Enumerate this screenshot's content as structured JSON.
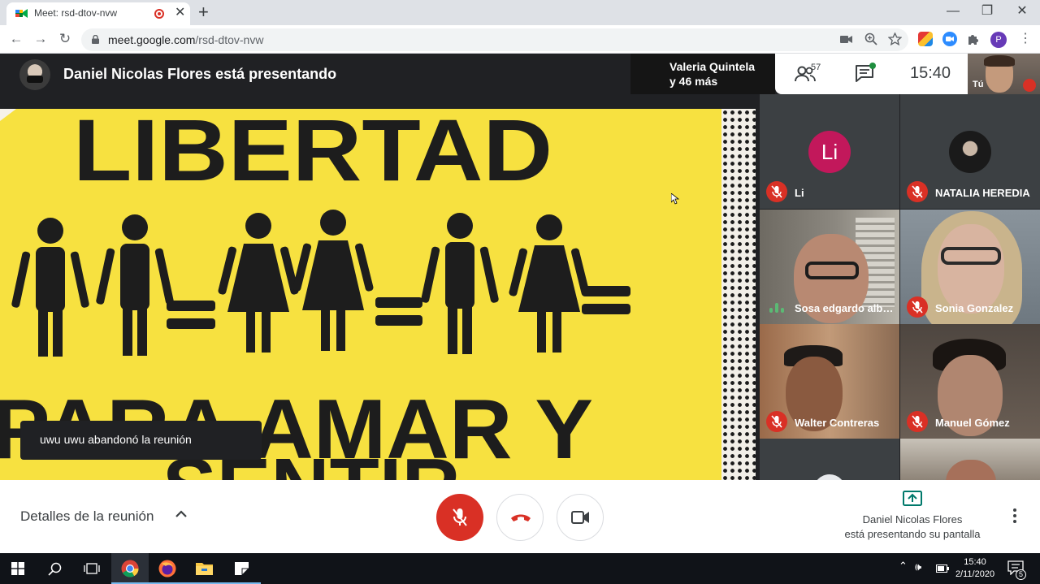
{
  "browser": {
    "tab_title": "Meet: rsd-dtov-nvw",
    "tab_close": "✕",
    "new_tab": "+",
    "url_host": "meet.google.com",
    "url_path": "/rsd-dtov-nvw",
    "window_min": "—",
    "window_max": "❐",
    "window_close": "✕",
    "back": "←",
    "forward": "→",
    "reload": "↻",
    "profile_initial": "P",
    "menu": "⋮"
  },
  "meet": {
    "presenting_banner": "Daniel Nicolas Flores está presentando",
    "active_speaker": {
      "name": "Valeria Quintela",
      "others": "y 46 más"
    },
    "people_count": "57",
    "clock": "15:40",
    "self_label": "Tú",
    "toast": "uwu uwu abandonó la reunión",
    "participants": [
      {
        "name": "Li",
        "avatar_letter": "Li",
        "muted": true
      },
      {
        "name": "NATALIA HEREDIA",
        "muted": true
      },
      {
        "name": "Sosa edgardo alberto",
        "muted": false,
        "talking": true
      },
      {
        "name": "Sonia Gonzalez",
        "muted": true
      },
      {
        "name": "Walter Contreras",
        "muted": true
      },
      {
        "name": "Manuel Gómez",
        "muted": true
      }
    ],
    "presentation": {
      "line1": "LIBERTAD",
      "line2": "PARA AMAR Y",
      "line3": "SENTIR"
    },
    "bottom": {
      "details": "Detalles de la reunión",
      "presenter_name": "Daniel Nicolas Flores",
      "presenter_status": "está presentando su pantalla"
    }
  },
  "taskbar": {
    "time": "15:40",
    "date": "2/11/2020",
    "notifications": "5",
    "tray_up": "⌃",
    "tray_sound": "🕪"
  },
  "colors": {
    "meet_red": "#d93025",
    "poster_yellow": "#f7e140",
    "avatar_pink": "#c2185b",
    "meet_dark": "#202124"
  }
}
